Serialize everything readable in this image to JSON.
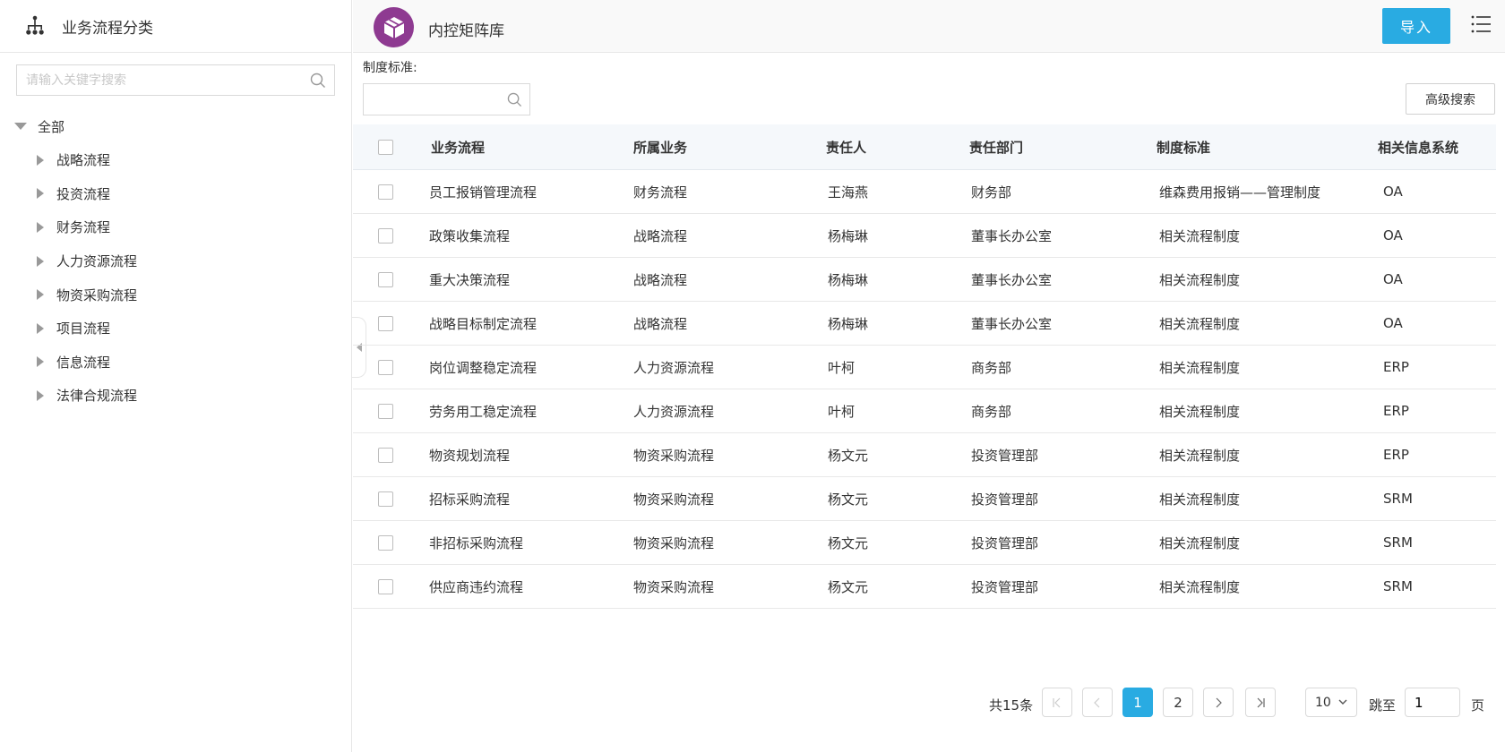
{
  "sidebar": {
    "title": "业务流程分类",
    "search_placeholder": "请输入关键字搜索",
    "root_label": "全部",
    "items": [
      {
        "label": "战略流程"
      },
      {
        "label": "投资流程"
      },
      {
        "label": "财务流程"
      },
      {
        "label": "人力资源流程"
      },
      {
        "label": "物资采购流程"
      },
      {
        "label": "项目流程"
      },
      {
        "label": "信息流程"
      },
      {
        "label": "法律合规流程"
      }
    ]
  },
  "header": {
    "app_title": "内控矩阵库",
    "import_label": "导入"
  },
  "filter": {
    "label": "制度标准:",
    "value": "",
    "advanced_label": "高级搜索"
  },
  "table": {
    "columns": [
      "业务流程",
      "所属业务",
      "责任人",
      "责任部门",
      "制度标准",
      "相关信息系统"
    ],
    "rows": [
      [
        "员工报销管理流程",
        "财务流程",
        "王海燕",
        "财务部",
        "维森费用报销——管理制度",
        "OA"
      ],
      [
        "政策收集流程",
        "战略流程",
        "杨梅琳",
        "董事长办公室",
        "相关流程制度",
        "OA"
      ],
      [
        "重大决策流程",
        "战略流程",
        "杨梅琳",
        "董事长办公室",
        "相关流程制度",
        "OA"
      ],
      [
        "战略目标制定流程",
        "战略流程",
        "杨梅琳",
        "董事长办公室",
        "相关流程制度",
        "OA"
      ],
      [
        "岗位调整稳定流程",
        "人力资源流程",
        "叶柯",
        "商务部",
        "相关流程制度",
        "ERP"
      ],
      [
        "劳务用工稳定流程",
        "人力资源流程",
        "叶柯",
        "商务部",
        "相关流程制度",
        "ERP"
      ],
      [
        "物资规划流程",
        "物资采购流程",
        "杨文元",
        "投资管理部",
        "相关流程制度",
        "ERP"
      ],
      [
        "招标采购流程",
        "物资采购流程",
        "杨文元",
        "投资管理部",
        "相关流程制度",
        "SRM"
      ],
      [
        "非招标采购流程",
        "物资采购流程",
        "杨文元",
        "投资管理部",
        "相关流程制度",
        "SRM"
      ],
      [
        "供应商违约流程",
        "物资采购流程",
        "杨文元",
        "投资管理部",
        "相关流程制度",
        "SRM"
      ]
    ]
  },
  "pagination": {
    "total_text": "共15条",
    "pages": [
      "1",
      "2"
    ],
    "current_page": "1",
    "page_size": "10",
    "goto_label": "跳至",
    "goto_value": "1",
    "page_unit": "页"
  },
  "colors": {
    "accent": "#29abe2",
    "logo": "#8e3a91"
  }
}
